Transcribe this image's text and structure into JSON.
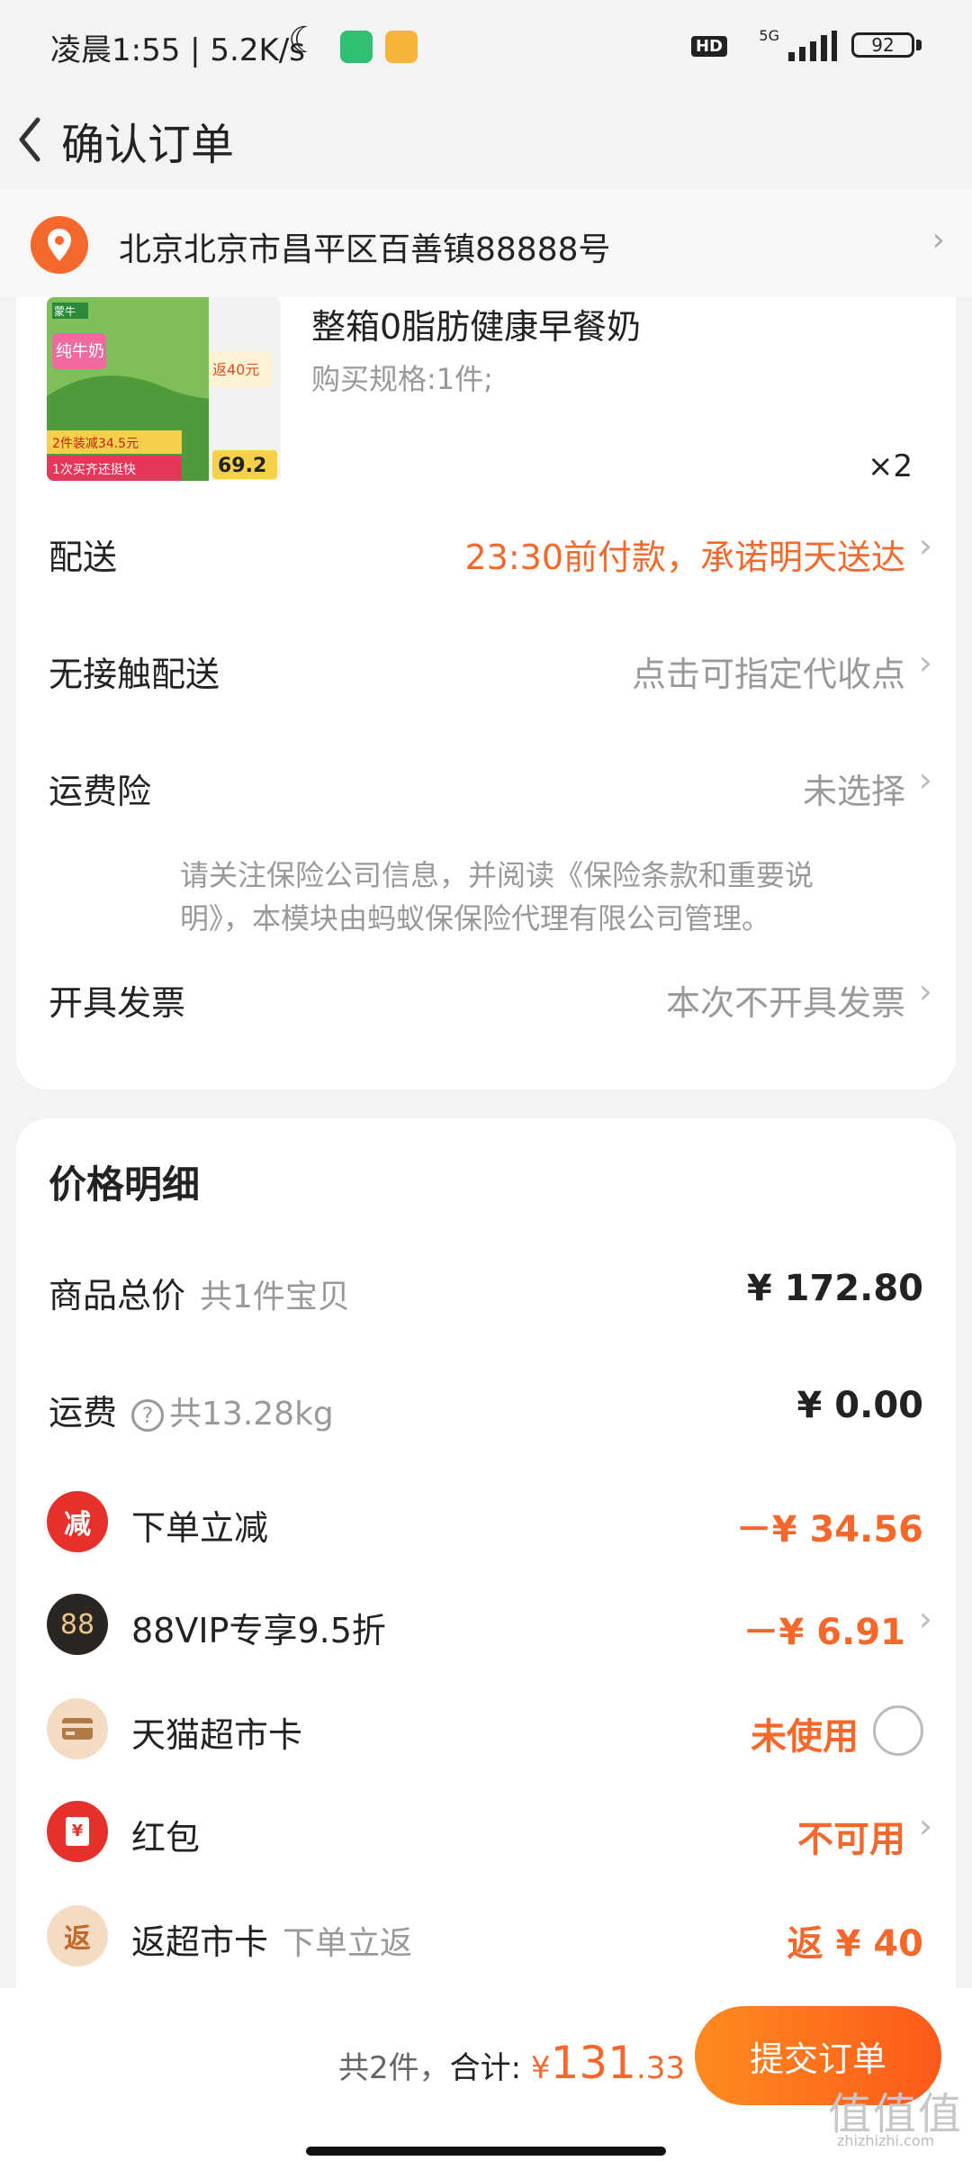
{
  "status_bar": {
    "time_speed": "凌晨1:55 | 5.2K/s",
    "network": "5G",
    "hd": "HD",
    "battery": "92",
    "colors": {
      "app1": "#2fbf71",
      "app2": "#f6b43a"
    }
  },
  "header": {
    "title": "确认订单"
  },
  "address": {
    "text": "北京北京市昌平区百善镇88888号"
  },
  "product": {
    "title": "整箱0脂肪健康早餐奶",
    "spec": "购买规格:1件;",
    "quantity": "×2",
    "image_text": {
      "brand": "蒙牛",
      "name": "纯牛奶",
      "promo1": "2件装减34.5元",
      "promo2": "1次买齐还挺快",
      "rebate": "返40元",
      "price": "69.2"
    }
  },
  "order_rows": {
    "delivery": {
      "label": "配送",
      "value": "23:30前付款，承诺明天送达"
    },
    "contactless": {
      "label": "无接触配送",
      "value": "点击可指定代收点"
    },
    "insurance": {
      "label": "运费险",
      "value": "未选择",
      "note": "请关注保险公司信息，并阅读《保险条款和重要说明》，本模块由蚂蚁保保险代理有限公司管理。"
    },
    "invoice": {
      "label": "开具发票",
      "value": "本次不开具发票"
    }
  },
  "price_detail": {
    "title": "价格明细",
    "goods_total": {
      "label": "商品总价",
      "sub": "共1件宝贝",
      "amount": "¥ 172.80"
    },
    "shipping": {
      "label": "运费",
      "sub": "共13.28kg",
      "amount": "¥ 0.00"
    },
    "instant_discount": {
      "icon_text": "减",
      "label": "下单立减",
      "amount": "－¥ 34.56"
    },
    "vip": {
      "icon_text": "88",
      "label": "88VIP专享9.5折",
      "amount": "－¥ 6.91"
    },
    "tmall_card": {
      "label": "天猫超市卡",
      "status": "未使用"
    },
    "red_packet": {
      "icon_text": "¥",
      "label": "红包",
      "status": "不可用"
    },
    "rebate_card": {
      "icon_text": "返",
      "label": "返超市卡",
      "sub": "下单立返",
      "amount": "返 ¥ 40"
    }
  },
  "footer": {
    "count": "共2件，",
    "total_label": "合计:",
    "currency": "¥",
    "total_int": "131",
    "total_dec": ".33",
    "submit": "提交订单"
  },
  "watermark": {
    "main": "值值值",
    "sub": "zhizhizhi.com"
  }
}
